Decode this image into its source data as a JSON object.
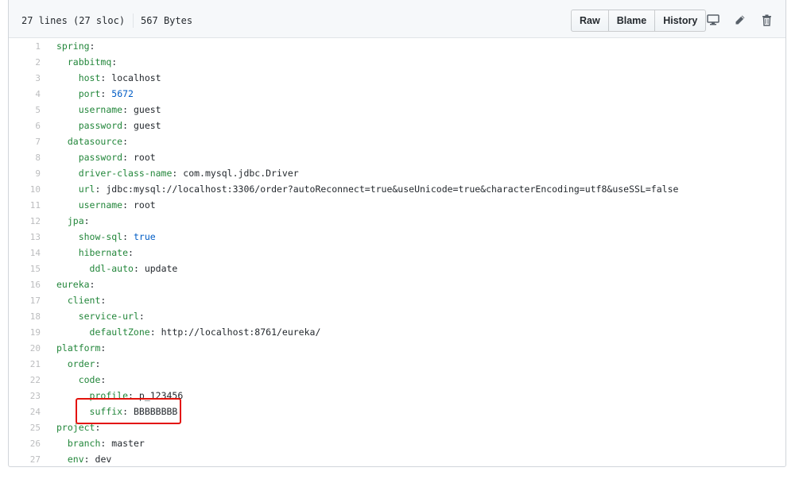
{
  "file_header": {
    "lines_info": "27 lines (27 sloc)",
    "size_info": "567 Bytes",
    "buttons": {
      "raw": "Raw",
      "blame": "Blame",
      "history": "History"
    },
    "icons": [
      "desktop-icon",
      "pencil-icon",
      "trash-icon"
    ]
  },
  "code_lines": [
    {
      "num": "1",
      "indent": "",
      "key": "spring",
      "value": ""
    },
    {
      "num": "2",
      "indent": "  ",
      "key": "rabbitmq",
      "value": ""
    },
    {
      "num": "3",
      "indent": "    ",
      "key": "host",
      "value": "localhost"
    },
    {
      "num": "4",
      "indent": "    ",
      "key": "port",
      "value": "5672"
    },
    {
      "num": "5",
      "indent": "    ",
      "key": "username",
      "value": "guest"
    },
    {
      "num": "6",
      "indent": "    ",
      "key": "password",
      "value": "guest"
    },
    {
      "num": "7",
      "indent": "  ",
      "key": "datasource",
      "value": ""
    },
    {
      "num": "8",
      "indent": "    ",
      "key": "password",
      "value": "root"
    },
    {
      "num": "9",
      "indent": "    ",
      "key": "driver-class-name",
      "value": "com.mysql.jdbc.Driver"
    },
    {
      "num": "10",
      "indent": "    ",
      "key": "url",
      "value": "jdbc:mysql://localhost:3306/order?autoReconnect=true&useUnicode=true&characterEncoding=utf8&useSSL=false"
    },
    {
      "num": "11",
      "indent": "    ",
      "key": "username",
      "value": "root"
    },
    {
      "num": "12",
      "indent": "  ",
      "key": "jpa",
      "value": ""
    },
    {
      "num": "13",
      "indent": "    ",
      "key": "show-sql",
      "value": "true"
    },
    {
      "num": "14",
      "indent": "    ",
      "key": "hibernate",
      "value": ""
    },
    {
      "num": "15",
      "indent": "      ",
      "key": "ddl-auto",
      "value": "update"
    },
    {
      "num": "16",
      "indent": "",
      "key": "eureka",
      "value": ""
    },
    {
      "num": "17",
      "indent": "  ",
      "key": "client",
      "value": ""
    },
    {
      "num": "18",
      "indent": "    ",
      "key": "service-url",
      "value": ""
    },
    {
      "num": "19",
      "indent": "      ",
      "key": "defaultZone",
      "value": "http://localhost:8761/eureka/"
    },
    {
      "num": "20",
      "indent": "",
      "key": "platform",
      "value": ""
    },
    {
      "num": "21",
      "indent": "  ",
      "key": "order",
      "value": ""
    },
    {
      "num": "22",
      "indent": "    ",
      "key": "code",
      "value": ""
    },
    {
      "num": "23",
      "indent": "      ",
      "key": "profile",
      "value": "p_123456"
    },
    {
      "num": "24",
      "indent": "      ",
      "key": "suffix",
      "value": "BBBBBBBB"
    },
    {
      "num": "25",
      "indent": "",
      "key": "project",
      "value": ""
    },
    {
      "num": "26",
      "indent": "  ",
      "key": "branch",
      "value": "master"
    },
    {
      "num": "27",
      "indent": "  ",
      "key": "env",
      "value": "dev"
    }
  ],
  "highlight_line": "24",
  "colors": {
    "key": "#22863a",
    "number": "#005cc5",
    "highlight_border": "#e3120b"
  }
}
